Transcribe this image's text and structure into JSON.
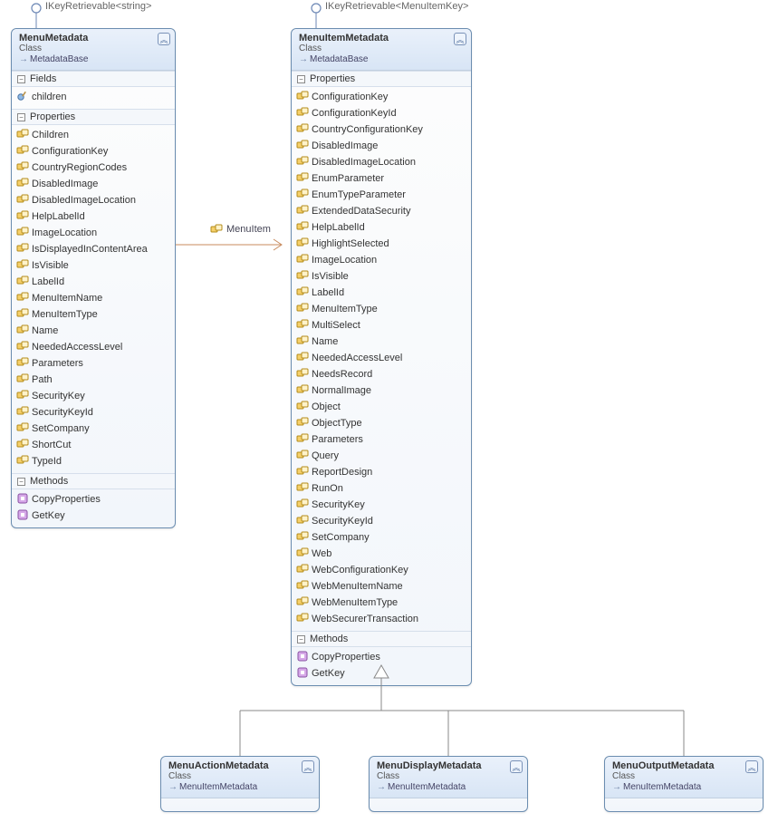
{
  "iface1": "IKeyRetrievable<string>",
  "iface2": "IKeyRetrievable<MenuItemKey>",
  "assoc": {
    "label": "MenuItem"
  },
  "box1": {
    "title": "MenuMetadata",
    "kind": "Class",
    "base": "MetadataBase",
    "sections": {
      "fields": {
        "title": "Fields",
        "items": [
          "children"
        ]
      },
      "props": {
        "title": "Properties",
        "items": [
          "Children",
          "ConfigurationKey",
          "CountryRegionCodes",
          "DisabledImage",
          "DisabledImageLocation",
          "HelpLabelId",
          "ImageLocation",
          "IsDisplayedInContentArea",
          "IsVisible",
          "LabelId",
          "MenuItemName",
          "MenuItemType",
          "Name",
          "NeededAccessLevel",
          "Parameters",
          "Path",
          "SecurityKey",
          "SecurityKeyId",
          "SetCompany",
          "ShortCut",
          "TypeId"
        ]
      },
      "methods": {
        "title": "Methods",
        "items": [
          "CopyProperties",
          "GetKey"
        ]
      }
    }
  },
  "box2": {
    "title": "MenuItemMetadata",
    "kind": "Class",
    "base": "MetadataBase",
    "sections": {
      "props": {
        "title": "Properties",
        "items": [
          "ConfigurationKey",
          "ConfigurationKeyId",
          "CountryConfigurationKey",
          "DisabledImage",
          "DisabledImageLocation",
          "EnumParameter",
          "EnumTypeParameter",
          "ExtendedDataSecurity",
          "HelpLabelId",
          "HighlightSelected",
          "ImageLocation",
          "IsVisible",
          "LabelId",
          "MenuItemType",
          "MultiSelect",
          "Name",
          "NeededAccessLevel",
          "NeedsRecord",
          "NormalImage",
          "Object",
          "ObjectType",
          "Parameters",
          "Query",
          "ReportDesign",
          "RunOn",
          "SecurityKey",
          "SecurityKeyId",
          "SetCompany",
          "Web",
          "WebConfigurationKey",
          "WebMenuItemName",
          "WebMenuItemType",
          "WebSecurerTransaction"
        ]
      },
      "methods": {
        "title": "Methods",
        "items": [
          "CopyProperties",
          "GetKey"
        ]
      }
    }
  },
  "box3": {
    "title": "MenuActionMetadata",
    "kind": "Class",
    "base": "MenuItemMetadata"
  },
  "box4": {
    "title": "MenuDisplayMetadata",
    "kind": "Class",
    "base": "MenuItemMetadata"
  },
  "box5": {
    "title": "MenuOutputMetadata",
    "kind": "Class",
    "base": "MenuItemMetadata"
  }
}
